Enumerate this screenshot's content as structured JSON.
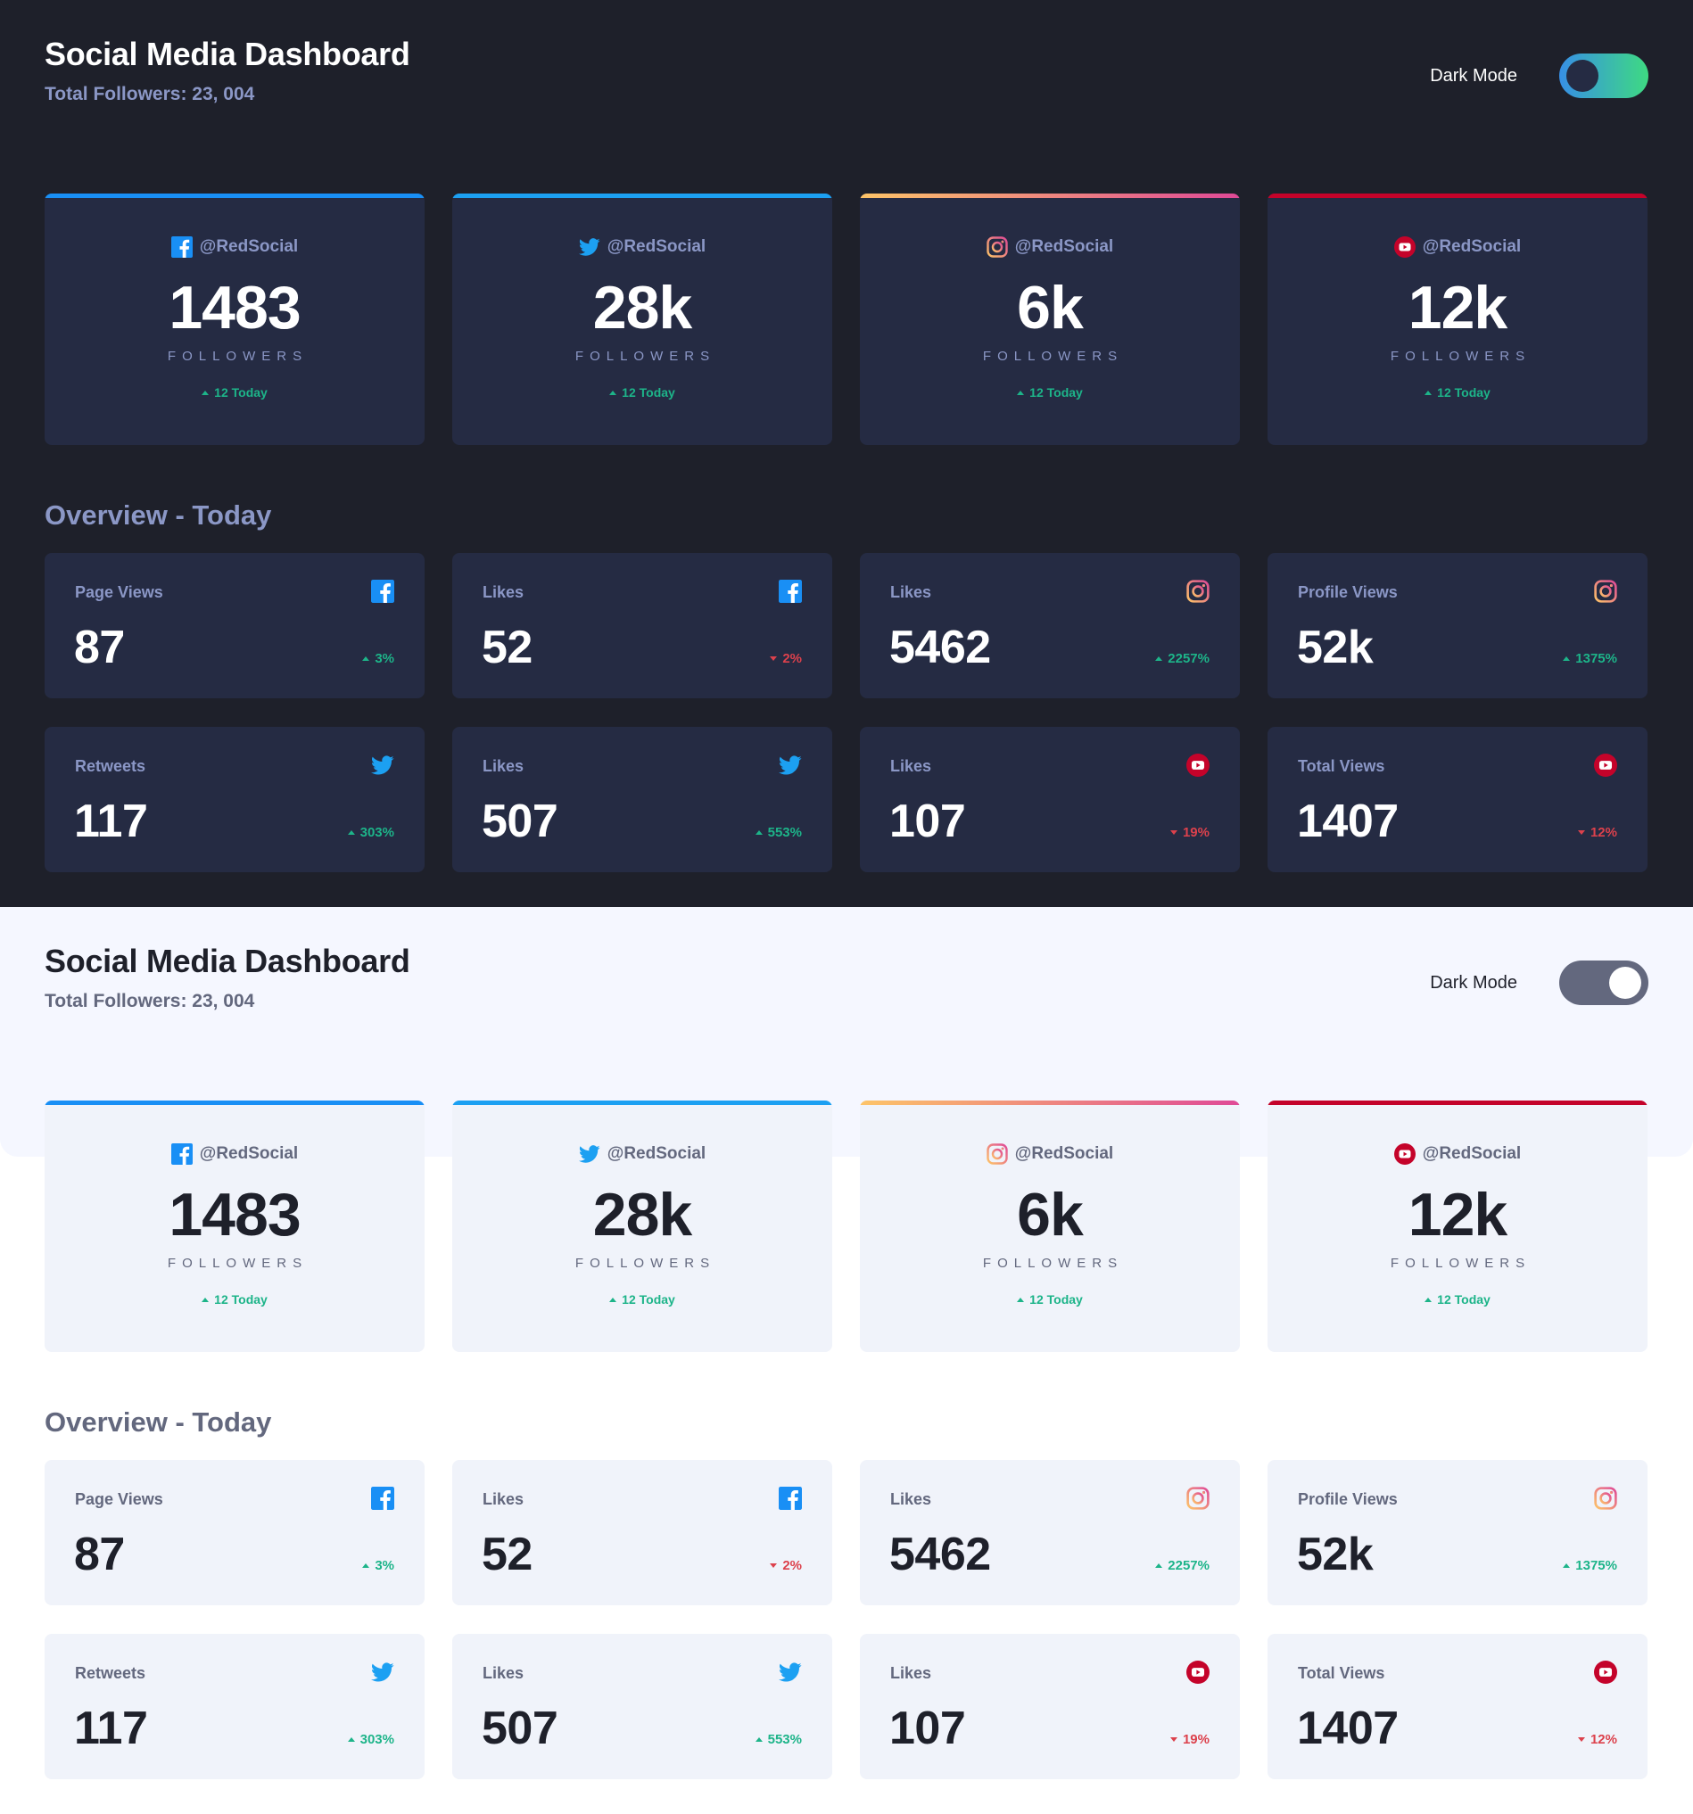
{
  "header": {
    "title": "Social Media Dashboard",
    "total_followers": "Total Followers: 23, 004"
  },
  "toggle": {
    "label": "Dark Mode"
  },
  "followers": [
    {
      "platform": "facebook",
      "handle": "@RedSocial",
      "count": "1483",
      "label": "FOLLOWERS",
      "today": "12 Today"
    },
    {
      "platform": "twitter",
      "handle": "@RedSocial",
      "count": "28k",
      "label": "FOLLOWERS",
      "today": "12 Today"
    },
    {
      "platform": "instagram",
      "handle": "@RedSocial",
      "count": "6k",
      "label": "FOLLOWERS",
      "today": "12 Today"
    },
    {
      "platform": "youtube",
      "handle": "@RedSocial",
      "count": "12k",
      "label": "FOLLOWERS",
      "today": "12 Today"
    }
  ],
  "overview": {
    "title": "Overview - Today",
    "cards": [
      {
        "platform": "facebook",
        "label": "Page Views",
        "value": "87",
        "change": "3%",
        "trend": "up"
      },
      {
        "platform": "facebook",
        "label": "Likes",
        "value": "52",
        "change": "2%",
        "trend": "down"
      },
      {
        "platform": "instagram",
        "label": "Likes",
        "value": "5462",
        "change": "2257%",
        "trend": "up"
      },
      {
        "platform": "instagram",
        "label": "Profile Views",
        "value": "52k",
        "change": "1375%",
        "trend": "up"
      },
      {
        "platform": "twitter",
        "label": "Retweets",
        "value": "117",
        "change": "303%",
        "trend": "up"
      },
      {
        "platform": "twitter",
        "label": "Likes",
        "value": "507",
        "change": "553%",
        "trend": "up"
      },
      {
        "platform": "youtube",
        "label": "Likes",
        "value": "107",
        "change": "19%",
        "trend": "down"
      },
      {
        "platform": "youtube",
        "label": "Total Views",
        "value": "1407",
        "change": "12%",
        "trend": "down"
      }
    ]
  },
  "colors": {
    "facebook": "#198ff5",
    "twitter": "#1ca0f2",
    "instagram_start": "#fdc468",
    "instagram_end": "#df4996",
    "youtube": "#c4032a",
    "up": "#1db489",
    "down": "#dc414c",
    "dark_bg": "#1e202a",
    "dark_card": "#252b43",
    "light_bg": "#ffffff",
    "light_card": "#f0f3fa"
  },
  "icons": {
    "facebook": "facebook-icon",
    "twitter": "twitter-icon",
    "instagram": "instagram-icon",
    "youtube": "youtube-icon"
  }
}
